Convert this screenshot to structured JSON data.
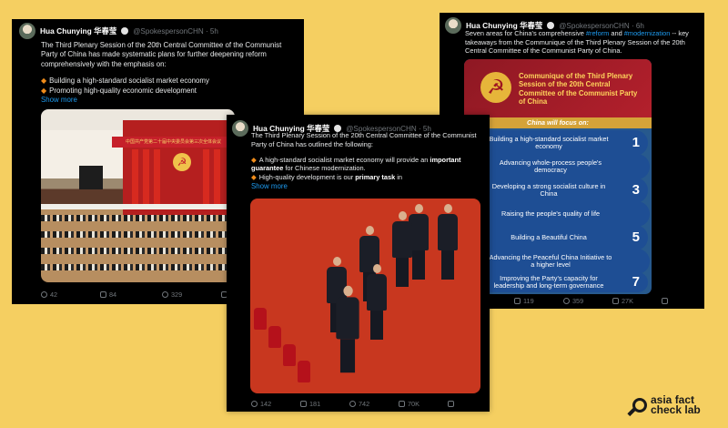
{
  "tweet1": {
    "name": "Hua Chunying 华春莹",
    "handle": "@SpokespersonCHN · 5h",
    "text": "The Third Plenary Session of the 20th Central Committee of the Communist Party of China has made systematic plans for further deepening reform comprehensively with the emphasis on:",
    "bullets": [
      "Building a high-standard socialist market economy",
      "Promoting high-quality economic development"
    ],
    "show_more": "Show more",
    "replies": "42",
    "retweets": "84",
    "likes": "329",
    "photo_banner": "中国共产党第二十届中央委员会第三次全体会议"
  },
  "tweet2": {
    "name": "Hua Chunying 华春莹",
    "handle": "@SpokespersonCHN · 6h",
    "text_pre": "Seven areas for China's comprehensive ",
    "tag1": "#reform",
    "text_mid": " and ",
    "tag2": "#modernization",
    "text_post": " -- key takeaways from the Communique of the Third Plenary Session of the 20th Central Committee of the Communist Party of China.",
    "graphic": {
      "title": "Communique of the Third Plenary Session of the 20th Central Committee of the Communist Party of China",
      "focus": "China will focus on:",
      "items": [
        {
          "num": "1",
          "text": "Building a high-standard socialist market economy"
        },
        {
          "num": "2",
          "text": "Advancing whole-process people's democracy"
        },
        {
          "num": "3",
          "text": "Developing a strong socialist culture in China"
        },
        {
          "num": "4",
          "text": "Raising the people's quality of life"
        },
        {
          "num": "5",
          "text": "Building a Beautiful China"
        },
        {
          "num": "6",
          "text": "Advancing the Peaceful China Initiative to a higher level"
        },
        {
          "num": "7",
          "text": "Improving the Party's capacity for leadership and long-term governance"
        }
      ]
    },
    "retweets": "119",
    "likes": "359",
    "views": "27K"
  },
  "tweet3": {
    "name": "Hua Chunying 华春莹",
    "handle": "@SpokespersonCHN · 5h",
    "text": "The Third Plenary Session of the 20th Central Committee of the Communist Party of China has outlined the following:",
    "b1_pre": "A high-standard socialist market economy will provide an ",
    "b1_bold": "important guarantee",
    "b1_post": " for Chinese modernization.",
    "b2_pre": "High-quality development is our ",
    "b2_bold": "primary task",
    "b2_post": " in",
    "show_more": "Show more",
    "replies": "142",
    "retweets": "181",
    "likes": "742",
    "views": "70K"
  },
  "logo": {
    "line1": "asia fact",
    "line2": "check lab"
  }
}
